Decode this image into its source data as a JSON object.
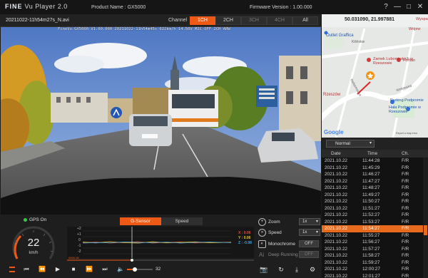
{
  "app": {
    "brand_fine": "FINE",
    "brand_rest": "Vu Player 2.0",
    "product": "Product Name : GX5000",
    "firmware": "Firmware Version : 1.00.000",
    "window_buttons": [
      "?",
      "—",
      "□",
      "✕"
    ]
  },
  "file": {
    "name": "20211022-11h54m27s_N.avi",
    "channel_label": "Channel",
    "channels": [
      "1CH",
      "2CH",
      "3CH",
      "4CH",
      "All"
    ]
  },
  "video": {
    "osd": "FineVu GX5000 V1.00.000 20211022-11h54m45s 022km/h 14.50V MIC OFF 2CH ARW"
  },
  "map": {
    "coords": "50.031090, 21.997881",
    "labels": [
      "Outlet Graffica",
      "Zamek Lubomirskich w Rzeszowie",
      "Fontan",
      "Rzeszów",
      "Parking Podpromie",
      "Hala Podpromie w Rzeszowie",
      "Wyspa",
      "Wojew",
      "Wołowska",
      "Kilińskie",
      "Reformacka"
    ],
    "google": "Google",
    "report": "Report a map error"
  },
  "list": {
    "filter": "Normal",
    "columns": [
      "Date",
      "Time",
      "Ch."
    ],
    "rows": [
      [
        "2021.10.22",
        "11:44:28",
        "F/R"
      ],
      [
        "2021.10.22",
        "11:45:29",
        "F/R"
      ],
      [
        "2021.10.22",
        "11:46:27",
        "F/R"
      ],
      [
        "2021.10.22",
        "11:47:27",
        "F/R"
      ],
      [
        "2021.10.22",
        "11:48:27",
        "F/R"
      ],
      [
        "2021.10.22",
        "11:49:27",
        "F/R"
      ],
      [
        "2021.10.22",
        "11:50:27",
        "F/R"
      ],
      [
        "2021.10.22",
        "11:51:27",
        "F/R"
      ],
      [
        "2021.10.22",
        "11:52:27",
        "F/R"
      ],
      [
        "2021.10.22",
        "11:53:27",
        "F/R"
      ],
      [
        "2021.10.22",
        "11:54:27",
        "F/R"
      ],
      [
        "2021.10.22",
        "11:55:27",
        "F/R"
      ],
      [
        "2021.10.22",
        "11:56:27",
        "F/R"
      ],
      [
        "2021.10.22",
        "11:57:27",
        "F/R"
      ],
      [
        "2021.10.22",
        "11:58:27",
        "F/R"
      ],
      [
        "2021.10.22",
        "11:59:27",
        "F/R"
      ],
      [
        "2021.10.22",
        "12:00:27",
        "F/R"
      ],
      [
        "2021.10.22",
        "12:01:27",
        "F/R"
      ]
    ],
    "selected_index": 10
  },
  "gps": {
    "label": "GPS On",
    "speed": "22",
    "unit": "km/h"
  },
  "graph": {
    "tabs": [
      "G-Sensor",
      "Speed"
    ],
    "y_ticks": [
      "+2",
      "+1",
      "0",
      "-1",
      "-2"
    ],
    "x_val": "X : 0.06",
    "y_val": "Y : 0.06",
    "z_val": "Z : -0.08",
    "time": "0000:18"
  },
  "controls": {
    "volume": "32"
  },
  "settings": {
    "zoom_label": "Zoom",
    "zoom_value": "1x",
    "speed_label": "Speed",
    "speed_value": "1x",
    "mono_label": "Monochrome",
    "mono_value": "OFF",
    "deep_label": "Deep Running",
    "deep_value": "OFF"
  },
  "colors": {
    "accent": "#ee5a16",
    "gps_on": "#39c94a",
    "x_axis": "#e0503a",
    "y_axis": "#e8c32a",
    "z_axis": "#3aa4e8"
  }
}
